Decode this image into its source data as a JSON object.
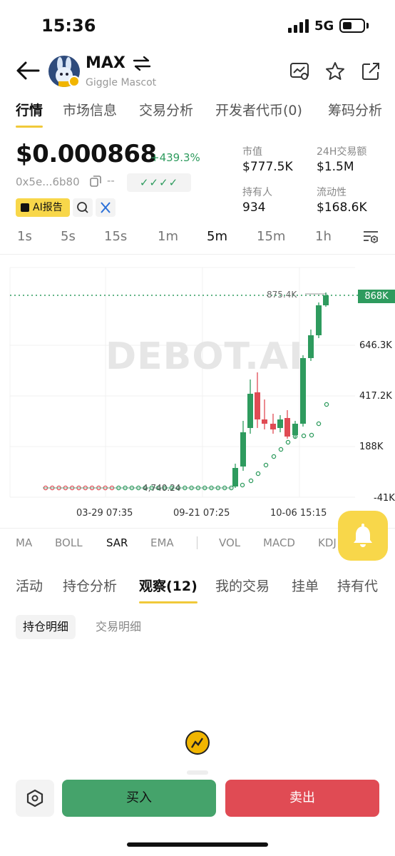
{
  "status": {
    "time": "15:36",
    "network": "5G"
  },
  "token": {
    "symbol": "MAX",
    "name": "Giggle Mascot"
  },
  "main_tabs": [
    "行情",
    "市场信息",
    "交易分析",
    "开发者代币(0)",
    "筹码分析"
  ],
  "price": {
    "value": "$0.000868",
    "change": "+439.3%",
    "address": "0x5e...6b80",
    "dashes": "--",
    "checks": "✓✓✓✓",
    "ai_report": "AI报告"
  },
  "stats": {
    "market_cap_label": "市值",
    "market_cap": "$777.5K",
    "volume_label": "24H交易额",
    "volume": "$1.5M",
    "holders_label": "持有人",
    "holders": "934",
    "liquidity_label": "流动性",
    "liquidity": "$168.6K"
  },
  "timeframes": [
    "1s",
    "5s",
    "15s",
    "1m",
    "5m",
    "15m",
    "1h"
  ],
  "active_timeframe": "5m",
  "chart": {
    "watermark": "DEBOT.AI",
    "y_labels": [
      "646.3K",
      "417.2K",
      "188K",
      "-41K"
    ],
    "current_price_tag": "868K",
    "max_label": "875.4K",
    "min_label": "4,740.24",
    "x_labels": [
      "03-29 07:35",
      "09-21 07:25",
      "10-06 15:15"
    ]
  },
  "indicators": [
    "MA",
    "BOLL",
    "SAR",
    "EMA",
    "VOL",
    "MACD",
    "KDJ"
  ],
  "activity_tabs": [
    "活动",
    "持仓分析",
    "观察(12)",
    "我的交易",
    "挂单",
    "持有代"
  ],
  "sub_tabs": [
    "持仓明细",
    "交易明细"
  ],
  "actions": {
    "buy": "买入",
    "sell": "卖出"
  },
  "colors": {
    "up": "#2e9b5e",
    "down": "#e04b54",
    "accent": "#f8d74a"
  }
}
